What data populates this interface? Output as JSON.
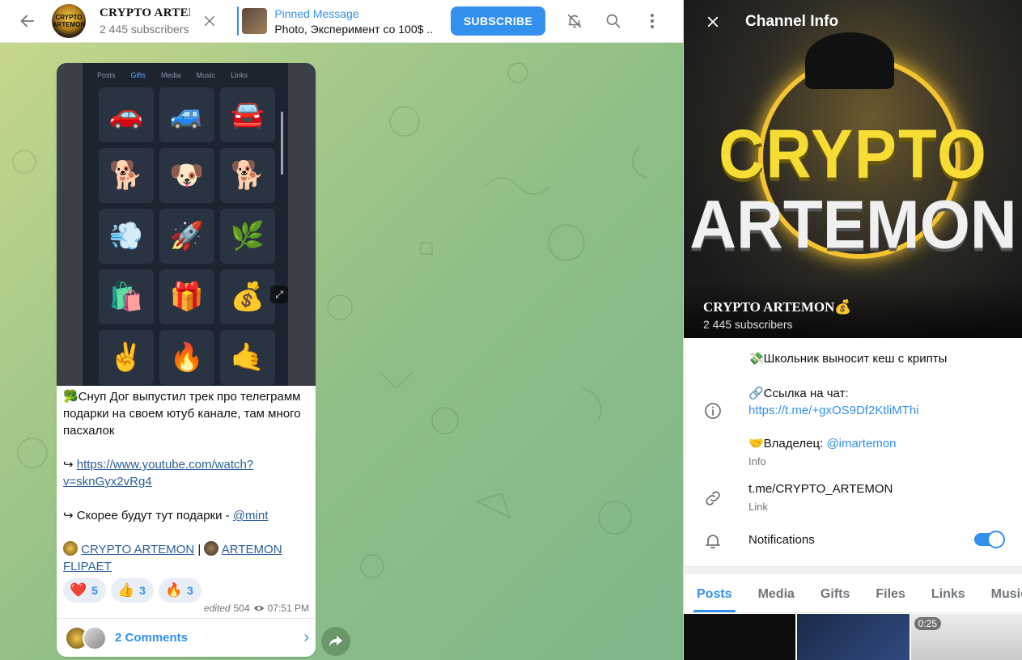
{
  "header": {
    "channel_title": "CRYPTO ARTEMON",
    "subscribers": "2 445 subscribers",
    "pinned_title": "Pinned Message",
    "pinned_text": "Photo, Эксперимент со 100$ ...",
    "subscribe_label": "SUBSCRIBE"
  },
  "message": {
    "phone_tabs": [
      "Posts",
      "Gifts",
      "Media",
      "Music",
      "Links"
    ],
    "line1": "Снуп Дог выпустил трек про телеграмм подарки на своем ютуб канале, там много пасхалок",
    "link_url": "https://www.youtube.com/watch?v=sknGyx2vRg4",
    "line3_text": "Скорее будут тут подарки - ",
    "mention": "@mint",
    "footer_link1": "CRYPTO ARTEMON",
    "footer_sep": " | ",
    "footer_link2": "ARTEMON FLIPAET",
    "reactions": [
      {
        "emoji": "❤️",
        "count": "5"
      },
      {
        "emoji": "👍",
        "count": "3"
      },
      {
        "emoji": "🔥",
        "count": "3"
      }
    ],
    "edited": "edited",
    "views": "504",
    "time": "07:51 PM",
    "comments_label": "2 Comments"
  },
  "panel": {
    "title": "Channel Info",
    "cover_line1": "CRYPTO",
    "cover_line2": "ARTEMON",
    "name": "CRYPTO ARTEMON💰",
    "subscribers": "2 445 subscribers",
    "desc1": "💸Школьник выносит кеш с крипты",
    "desc2": "🔗Ссылка на чат:",
    "chat_link": "https://t.me/+gxOS9Df2KtliMThi",
    "owner_text": "🤝Владелец: ",
    "owner_handle": "@imartemon",
    "info_caption": "Info",
    "link_value": "t.me/CRYPTO_ARTEMON",
    "link_caption": "Link",
    "notifications_label": "Notifications",
    "notifications_on": true,
    "tabs": [
      "Posts",
      "Media",
      "Gifts",
      "Files",
      "Links",
      "Music"
    ],
    "active_tab": "Posts",
    "thumb_duration": "0:25"
  }
}
